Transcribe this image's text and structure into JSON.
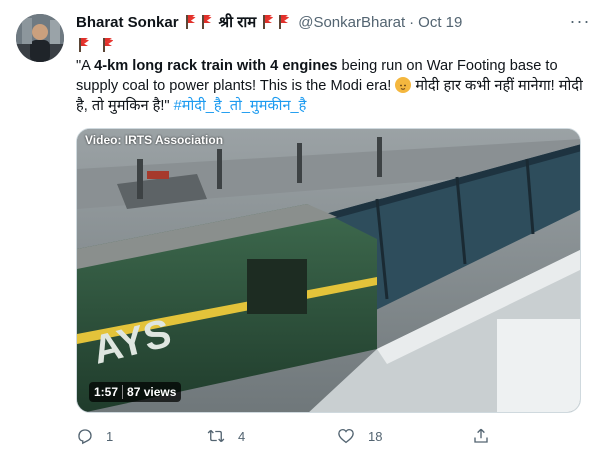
{
  "tweet": {
    "author_name": "Bharat Sonkar",
    "name_text": "श्री राम",
    "handle": "@SonkarBharat",
    "separator": "·",
    "date": "Oct 19",
    "more_label": "···",
    "text_parts": {
      "p1": "\"A ",
      "b1": "4-km long rack train with 4 engines",
      "p2": " being run on War Footing base to supply coal to power plants! This is the Modi era! ",
      "p3": " मोदी हार कभी नहीं मानेगा! मोदी है, तो मुमकिन है!\" ",
      "hashtag": "#मोदी_है_तो_मुमकीन_है"
    },
    "media": {
      "credit": "Video: IRTS Association",
      "duration": "1:57",
      "views": "87 views"
    },
    "actions": {
      "reply_count": "1",
      "retweet_count": "4",
      "like_count": "18"
    }
  },
  "colors": {
    "link": "#1d9bf0",
    "secondary_text": "#536471",
    "flag_red": "#e8352e"
  }
}
